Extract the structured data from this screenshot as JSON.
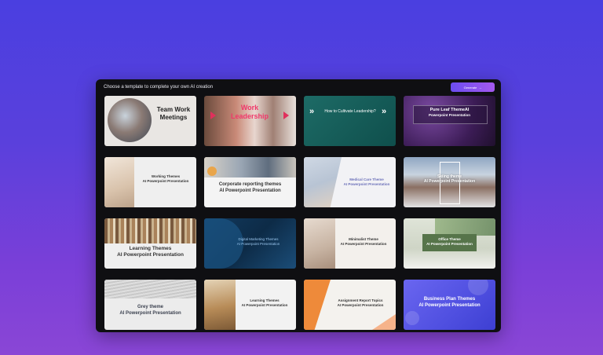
{
  "panel": {
    "title": "Choose a template to complete your own AI creation",
    "generate_button": "Generate",
    "generate_arrow": "→"
  },
  "templates": [
    {
      "title": "Team Work Meetings",
      "subtitle": ""
    },
    {
      "title": "Work",
      "subtitle": "Leadership"
    },
    {
      "title": "How to Cultivate Leadership?",
      "subtitle": ""
    },
    {
      "title": "Pure Leaf ThemeAI",
      "subtitle": "Powerpoint Presentation"
    },
    {
      "title": "Working Themes",
      "subtitle": "AI Powerpoint Presentation"
    },
    {
      "title": "Corporate reporting themes",
      "subtitle": "AI Powerpoint Presentation"
    },
    {
      "title": "Medical Care Theme",
      "subtitle": "AI Powerpoint Presentation"
    },
    {
      "title": "Skiing theme",
      "subtitle": "AI Powerpoint Presentation"
    },
    {
      "title": "Learning Themes",
      "subtitle": "AI Powerpoint Presentation"
    },
    {
      "title": "Digital Marketing Themes",
      "subtitle": "AI Powerpoint Presentation"
    },
    {
      "title": "Minimalist Theme",
      "subtitle": "AI Powerpoint Presentation"
    },
    {
      "title": "Office Theme",
      "subtitle": "AI Powerpoint Presentation"
    },
    {
      "title": "Grey theme",
      "subtitle": "AI Powerpoint Presentation"
    },
    {
      "title": "Learning Themes",
      "subtitle": "AI Powerpoint Presentation"
    },
    {
      "title": "Assignment Report Topics",
      "subtitle": "AI Powerpoint Presentation"
    },
    {
      "title": "Business Plan Themes",
      "subtitle": "AI Powerpoint Presentation"
    }
  ]
}
